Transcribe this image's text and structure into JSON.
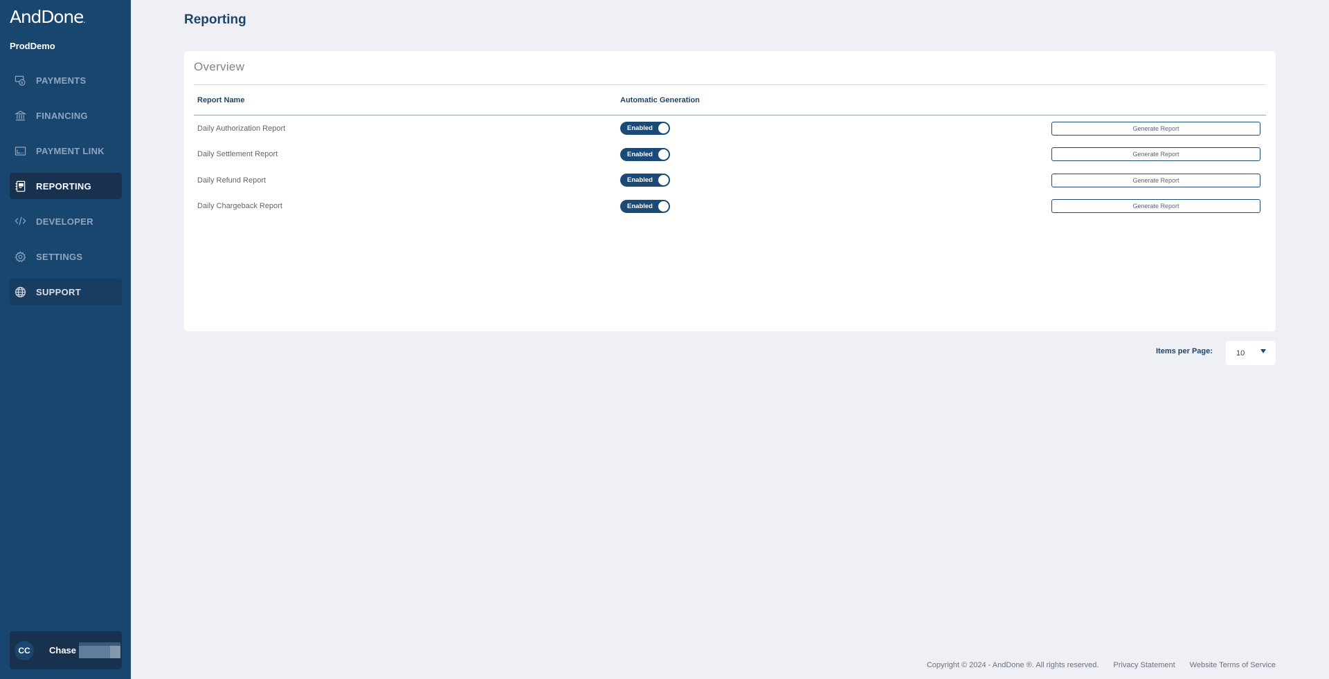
{
  "brand": {
    "logo_text": "AndDone",
    "logo_dot": "."
  },
  "org": {
    "name": "ProdDemo"
  },
  "sidebar": {
    "items": [
      {
        "label": "PAYMENTS",
        "icon": "payments-icon",
        "active": false
      },
      {
        "label": "FINANCING",
        "icon": "bank-icon",
        "active": false
      },
      {
        "label": "PAYMENT LINK",
        "icon": "payment-link-icon",
        "active": false
      },
      {
        "label": "REPORTING",
        "icon": "report-icon",
        "active": true
      },
      {
        "label": "DEVELOPER",
        "icon": "code-icon",
        "active": false
      },
      {
        "label": "SETTINGS",
        "icon": "gear-icon",
        "active": false
      },
      {
        "label": "SUPPORT",
        "icon": "globe-icon",
        "active": false
      }
    ]
  },
  "user": {
    "initials": "CC",
    "first_name": "Chase"
  },
  "page": {
    "title": "Reporting"
  },
  "overview": {
    "title": "Overview",
    "columns": {
      "name": "Report Name",
      "generation": "Automatic Generation"
    },
    "rows": [
      {
        "name": "Daily Authorization Report",
        "status": "Enabled",
        "action": "Generate Report"
      },
      {
        "name": "Daily Settlement Report",
        "status": "Enabled",
        "action": "Generate Report"
      },
      {
        "name": "Daily Refund Report",
        "status": "Enabled",
        "action": "Generate Report"
      },
      {
        "name": "Daily Chargeback Report",
        "status": "Enabled",
        "action": "Generate Report"
      }
    ]
  },
  "pagination": {
    "label": "Items per Page:",
    "value": "10"
  },
  "footer": {
    "copyright": "Copyright © 2024 - AndDone ®. All rights reserved.",
    "privacy": "Privacy Statement",
    "terms": "Website Terms of Service"
  },
  "colors": {
    "sidebar": "#19466f",
    "accent": "#1b4a77",
    "background": "#eef0f5"
  }
}
